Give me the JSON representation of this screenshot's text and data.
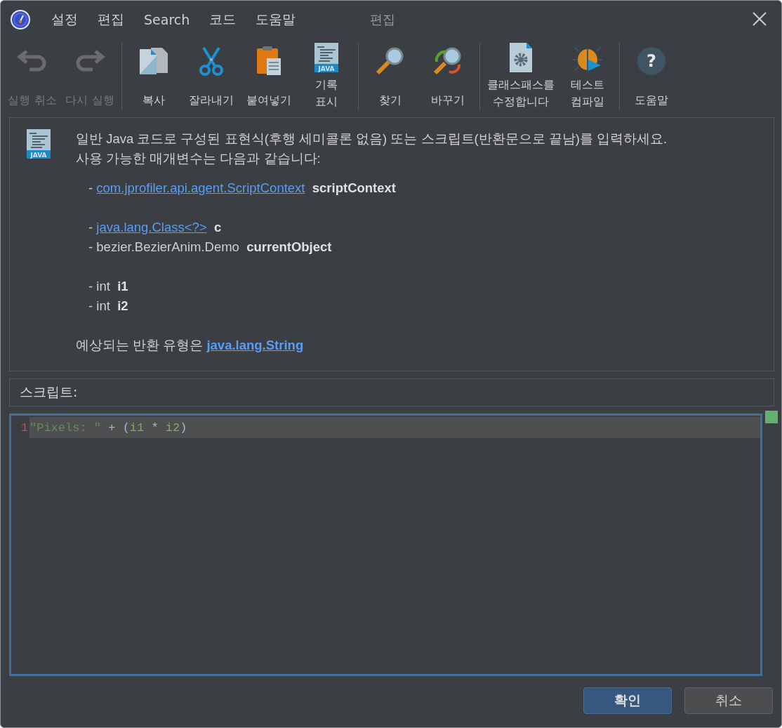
{
  "window": {
    "title": "편집"
  },
  "menu": [
    "설정",
    "편집",
    "Search",
    "코드",
    "도움말"
  ],
  "toolbar": {
    "groups": [
      [
        {
          "kind": "undo",
          "label": [
            "실행 취소"
          ],
          "disabled": true
        },
        {
          "kind": "redo",
          "label": [
            "다시 실행"
          ],
          "disabled": true
        }
      ],
      [
        {
          "kind": "copy",
          "label": [
            "복사"
          ],
          "disabled": false
        },
        {
          "kind": "cut",
          "label": [
            "잘라내기"
          ],
          "disabled": false
        },
        {
          "kind": "paste",
          "label": [
            "붙여넣기"
          ],
          "disabled": false
        },
        {
          "kind": "java",
          "icon_text": "JAVA",
          "label": [
            "기록",
            "표시"
          ],
          "disabled": false
        }
      ],
      [
        {
          "kind": "find",
          "label": [
            "찾기"
          ],
          "disabled": false
        },
        {
          "kind": "replace",
          "label": [
            "바꾸기"
          ],
          "disabled": false
        }
      ],
      [
        {
          "kind": "classpath",
          "label": [
            "클래스패스를",
            "수정합니다"
          ],
          "disabled": false
        },
        {
          "kind": "bug",
          "label": [
            "테스트",
            "컴파일"
          ],
          "disabled": false
        }
      ],
      [
        {
          "kind": "help",
          "icon_text": "?",
          "label": [
            "도움말"
          ],
          "disabled": false
        }
      ]
    ]
  },
  "description": {
    "icon_text": "JAVA",
    "intro": [
      "일반 Java 코드로 구성된 표현식(후행 세미콜론 없음) 또는 스크립트(반환문으로 끝남)를 입력하세요.",
      "사용 가능한 매개변수는 다음과 같습니다:"
    ],
    "parameter_groups": [
      [
        {
          "bullet": "-",
          "type": "com.jprofiler.api.agent.ScriptContext",
          "link": true,
          "name": "scriptContext"
        }
      ],
      [
        {
          "bullet": "-",
          "type": "java.lang.Class<?>",
          "link": true,
          "name": "c"
        },
        {
          "bullet": "-",
          "type": "bezier.BezierAnim.Demo",
          "link": false,
          "name": "currentObject"
        }
      ],
      [
        {
          "bullet": "-",
          "type": "int",
          "link": false,
          "name": "i1"
        },
        {
          "bullet": "-",
          "type": "int",
          "link": false,
          "name": "i2"
        }
      ]
    ],
    "return_text": "예상되는 반환 유형은",
    "return_type": "java.lang.String"
  },
  "script_label": "스크립트:",
  "editor": {
    "lines": [
      {
        "number": "1",
        "current": true,
        "tokens": [
          {
            "kind": "string",
            "text": "\"Pixels: \""
          },
          {
            "kind": "plain",
            "text": " + ("
          },
          {
            "kind": "var",
            "text": "i1"
          },
          {
            "kind": "plain",
            "text": " * "
          },
          {
            "kind": "var",
            "text": "i2"
          },
          {
            "kind": "plain",
            "text": ")"
          }
        ]
      }
    ]
  },
  "buttons": [
    {
      "label": "확인",
      "default": true
    },
    {
      "label": "취소",
      "default": false
    }
  ]
}
